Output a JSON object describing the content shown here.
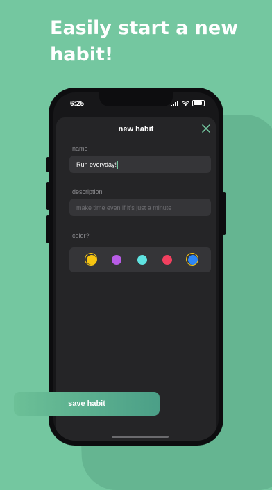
{
  "headline": "Easily start a new habit!",
  "status_bar": {
    "time": "6:25"
  },
  "sheet": {
    "title": "new habit",
    "close_icon": "close-icon",
    "name_label": "name",
    "name_value": "Run everyday!",
    "description_label": "description",
    "description_placeholder": "make time even if it's just a minute",
    "color_label": "color?",
    "colors": [
      {
        "name": "yellow",
        "hex": "#f7c511",
        "selected": true
      },
      {
        "name": "purple",
        "hex": "#b85ce6",
        "selected": false
      },
      {
        "name": "cyan",
        "hex": "#5fe3e1",
        "selected": false
      },
      {
        "name": "red",
        "hex": "#f2405f",
        "selected": false
      },
      {
        "name": "blue",
        "hex": "#2e86f5",
        "selected": false,
        "ring": "#f7c511"
      }
    ],
    "save_label": "save habit"
  },
  "colors": {
    "background": "#74c7a0",
    "accent": "#74c7a0"
  }
}
